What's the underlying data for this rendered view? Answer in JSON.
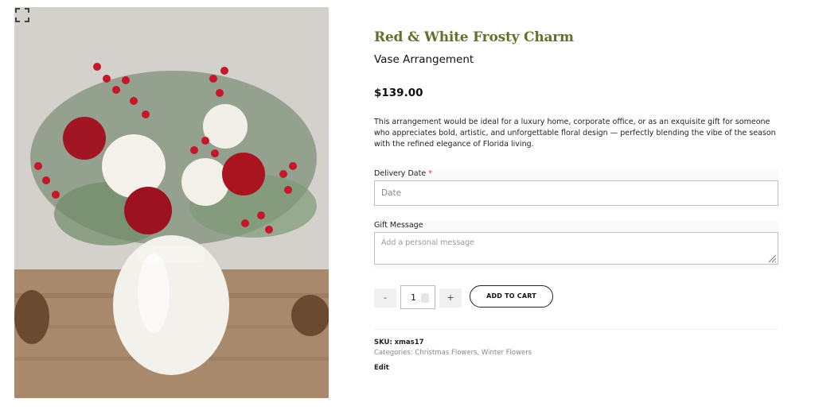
{
  "product": {
    "title": "Red & White Frosty Charm",
    "subtitle": "Vase Arrangement",
    "price": "$139.00",
    "description": "This arrangement would be ideal for a luxury home, corporate office, or as an exquisite gift for someone who appreciates bold, artistic, and unforgettable floral design — perfectly blending the vibe of the season with the refined elegance of Florida living."
  },
  "form": {
    "delivery_label": "Delivery Date",
    "required_mark": "*",
    "date_placeholder": "Date",
    "gift_label": "Gift Message",
    "gift_placeholder": "Add a personal message"
  },
  "cart": {
    "minus_label": "-",
    "quantity": "1",
    "plus_label": "+",
    "add_label": "ADD TO CART"
  },
  "meta": {
    "sku_label": "SKU:",
    "sku_value": "xmas17",
    "categories_label": "Categories:",
    "category_1": "Christmas Flowers",
    "separator": ",",
    "category_2": "Winter Flowers",
    "edit_label": "Edit"
  },
  "icons": {
    "zoom": "fullscreen-icon",
    "resize": "resize-grip-icon"
  },
  "colors": {
    "title": "#6a6c2c",
    "required": "#dd3333",
    "meta": "#888888"
  }
}
